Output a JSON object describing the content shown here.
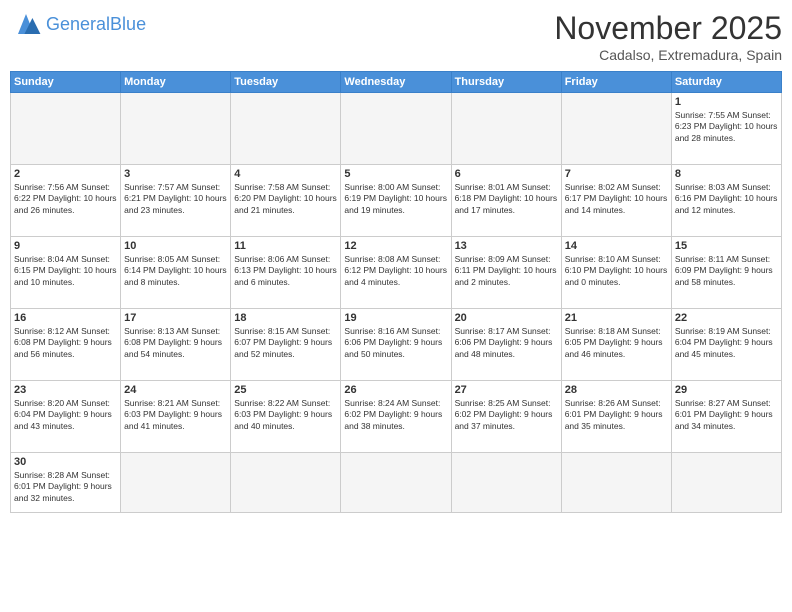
{
  "header": {
    "logo_general": "General",
    "logo_blue": "Blue",
    "month_title": "November 2025",
    "location": "Cadalso, Extremadura, Spain"
  },
  "weekdays": [
    "Sunday",
    "Monday",
    "Tuesday",
    "Wednesday",
    "Thursday",
    "Friday",
    "Saturday"
  ],
  "weeks": [
    [
      {
        "day": "",
        "info": ""
      },
      {
        "day": "",
        "info": ""
      },
      {
        "day": "",
        "info": ""
      },
      {
        "day": "",
        "info": ""
      },
      {
        "day": "",
        "info": ""
      },
      {
        "day": "",
        "info": ""
      },
      {
        "day": "1",
        "info": "Sunrise: 7:55 AM\nSunset: 6:23 PM\nDaylight: 10 hours\nand 28 minutes."
      }
    ],
    [
      {
        "day": "2",
        "info": "Sunrise: 7:56 AM\nSunset: 6:22 PM\nDaylight: 10 hours\nand 26 minutes."
      },
      {
        "day": "3",
        "info": "Sunrise: 7:57 AM\nSunset: 6:21 PM\nDaylight: 10 hours\nand 23 minutes."
      },
      {
        "day": "4",
        "info": "Sunrise: 7:58 AM\nSunset: 6:20 PM\nDaylight: 10 hours\nand 21 minutes."
      },
      {
        "day": "5",
        "info": "Sunrise: 8:00 AM\nSunset: 6:19 PM\nDaylight: 10 hours\nand 19 minutes."
      },
      {
        "day": "6",
        "info": "Sunrise: 8:01 AM\nSunset: 6:18 PM\nDaylight: 10 hours\nand 17 minutes."
      },
      {
        "day": "7",
        "info": "Sunrise: 8:02 AM\nSunset: 6:17 PM\nDaylight: 10 hours\nand 14 minutes."
      },
      {
        "day": "8",
        "info": "Sunrise: 8:03 AM\nSunset: 6:16 PM\nDaylight: 10 hours\nand 12 minutes."
      }
    ],
    [
      {
        "day": "9",
        "info": "Sunrise: 8:04 AM\nSunset: 6:15 PM\nDaylight: 10 hours\nand 10 minutes."
      },
      {
        "day": "10",
        "info": "Sunrise: 8:05 AM\nSunset: 6:14 PM\nDaylight: 10 hours\nand 8 minutes."
      },
      {
        "day": "11",
        "info": "Sunrise: 8:06 AM\nSunset: 6:13 PM\nDaylight: 10 hours\nand 6 minutes."
      },
      {
        "day": "12",
        "info": "Sunrise: 8:08 AM\nSunset: 6:12 PM\nDaylight: 10 hours\nand 4 minutes."
      },
      {
        "day": "13",
        "info": "Sunrise: 8:09 AM\nSunset: 6:11 PM\nDaylight: 10 hours\nand 2 minutes."
      },
      {
        "day": "14",
        "info": "Sunrise: 8:10 AM\nSunset: 6:10 PM\nDaylight: 10 hours\nand 0 minutes."
      },
      {
        "day": "15",
        "info": "Sunrise: 8:11 AM\nSunset: 6:09 PM\nDaylight: 9 hours\nand 58 minutes."
      }
    ],
    [
      {
        "day": "16",
        "info": "Sunrise: 8:12 AM\nSunset: 6:08 PM\nDaylight: 9 hours\nand 56 minutes."
      },
      {
        "day": "17",
        "info": "Sunrise: 8:13 AM\nSunset: 6:08 PM\nDaylight: 9 hours\nand 54 minutes."
      },
      {
        "day": "18",
        "info": "Sunrise: 8:15 AM\nSunset: 6:07 PM\nDaylight: 9 hours\nand 52 minutes."
      },
      {
        "day": "19",
        "info": "Sunrise: 8:16 AM\nSunset: 6:06 PM\nDaylight: 9 hours\nand 50 minutes."
      },
      {
        "day": "20",
        "info": "Sunrise: 8:17 AM\nSunset: 6:06 PM\nDaylight: 9 hours\nand 48 minutes."
      },
      {
        "day": "21",
        "info": "Sunrise: 8:18 AM\nSunset: 6:05 PM\nDaylight: 9 hours\nand 46 minutes."
      },
      {
        "day": "22",
        "info": "Sunrise: 8:19 AM\nSunset: 6:04 PM\nDaylight: 9 hours\nand 45 minutes."
      }
    ],
    [
      {
        "day": "23",
        "info": "Sunrise: 8:20 AM\nSunset: 6:04 PM\nDaylight: 9 hours\nand 43 minutes."
      },
      {
        "day": "24",
        "info": "Sunrise: 8:21 AM\nSunset: 6:03 PM\nDaylight: 9 hours\nand 41 minutes."
      },
      {
        "day": "25",
        "info": "Sunrise: 8:22 AM\nSunset: 6:03 PM\nDaylight: 9 hours\nand 40 minutes."
      },
      {
        "day": "26",
        "info": "Sunrise: 8:24 AM\nSunset: 6:02 PM\nDaylight: 9 hours\nand 38 minutes."
      },
      {
        "day": "27",
        "info": "Sunrise: 8:25 AM\nSunset: 6:02 PM\nDaylight: 9 hours\nand 37 minutes."
      },
      {
        "day": "28",
        "info": "Sunrise: 8:26 AM\nSunset: 6:01 PM\nDaylight: 9 hours\nand 35 minutes."
      },
      {
        "day": "29",
        "info": "Sunrise: 8:27 AM\nSunset: 6:01 PM\nDaylight: 9 hours\nand 34 minutes."
      }
    ],
    [
      {
        "day": "30",
        "info": "Sunrise: 8:28 AM\nSunset: 6:01 PM\nDaylight: 9 hours\nand 32 minutes."
      },
      {
        "day": "",
        "info": ""
      },
      {
        "day": "",
        "info": ""
      },
      {
        "day": "",
        "info": ""
      },
      {
        "day": "",
        "info": ""
      },
      {
        "day": "",
        "info": ""
      },
      {
        "day": "",
        "info": ""
      }
    ]
  ]
}
